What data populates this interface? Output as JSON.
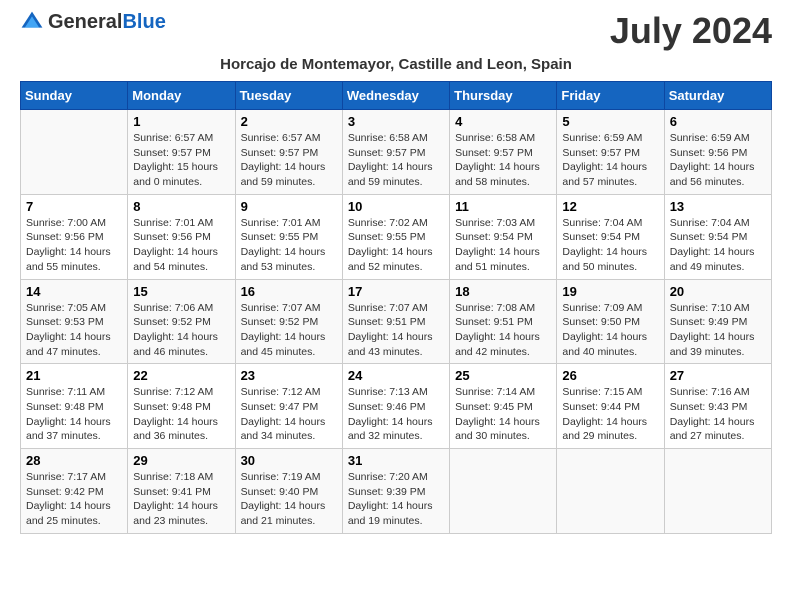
{
  "logo": {
    "general": "General",
    "blue": "Blue"
  },
  "title": "July 2024",
  "location": "Horcajo de Montemayor, Castille and Leon, Spain",
  "headers": [
    "Sunday",
    "Monday",
    "Tuesday",
    "Wednesday",
    "Thursday",
    "Friday",
    "Saturday"
  ],
  "weeks": [
    [
      {
        "date": "",
        "info": ""
      },
      {
        "date": "1",
        "info": "Sunrise: 6:57 AM\nSunset: 9:57 PM\nDaylight: 15 hours\nand 0 minutes."
      },
      {
        "date": "2",
        "info": "Sunrise: 6:57 AM\nSunset: 9:57 PM\nDaylight: 14 hours\nand 59 minutes."
      },
      {
        "date": "3",
        "info": "Sunrise: 6:58 AM\nSunset: 9:57 PM\nDaylight: 14 hours\nand 59 minutes."
      },
      {
        "date": "4",
        "info": "Sunrise: 6:58 AM\nSunset: 9:57 PM\nDaylight: 14 hours\nand 58 minutes."
      },
      {
        "date": "5",
        "info": "Sunrise: 6:59 AM\nSunset: 9:57 PM\nDaylight: 14 hours\nand 57 minutes."
      },
      {
        "date": "6",
        "info": "Sunrise: 6:59 AM\nSunset: 9:56 PM\nDaylight: 14 hours\nand 56 minutes."
      }
    ],
    [
      {
        "date": "7",
        "info": "Sunrise: 7:00 AM\nSunset: 9:56 PM\nDaylight: 14 hours\nand 55 minutes."
      },
      {
        "date": "8",
        "info": "Sunrise: 7:01 AM\nSunset: 9:56 PM\nDaylight: 14 hours\nand 54 minutes."
      },
      {
        "date": "9",
        "info": "Sunrise: 7:01 AM\nSunset: 9:55 PM\nDaylight: 14 hours\nand 53 minutes."
      },
      {
        "date": "10",
        "info": "Sunrise: 7:02 AM\nSunset: 9:55 PM\nDaylight: 14 hours\nand 52 minutes."
      },
      {
        "date": "11",
        "info": "Sunrise: 7:03 AM\nSunset: 9:54 PM\nDaylight: 14 hours\nand 51 minutes."
      },
      {
        "date": "12",
        "info": "Sunrise: 7:04 AM\nSunset: 9:54 PM\nDaylight: 14 hours\nand 50 minutes."
      },
      {
        "date": "13",
        "info": "Sunrise: 7:04 AM\nSunset: 9:54 PM\nDaylight: 14 hours\nand 49 minutes."
      }
    ],
    [
      {
        "date": "14",
        "info": "Sunrise: 7:05 AM\nSunset: 9:53 PM\nDaylight: 14 hours\nand 47 minutes."
      },
      {
        "date": "15",
        "info": "Sunrise: 7:06 AM\nSunset: 9:52 PM\nDaylight: 14 hours\nand 46 minutes."
      },
      {
        "date": "16",
        "info": "Sunrise: 7:07 AM\nSunset: 9:52 PM\nDaylight: 14 hours\nand 45 minutes."
      },
      {
        "date": "17",
        "info": "Sunrise: 7:07 AM\nSunset: 9:51 PM\nDaylight: 14 hours\nand 43 minutes."
      },
      {
        "date": "18",
        "info": "Sunrise: 7:08 AM\nSunset: 9:51 PM\nDaylight: 14 hours\nand 42 minutes."
      },
      {
        "date": "19",
        "info": "Sunrise: 7:09 AM\nSunset: 9:50 PM\nDaylight: 14 hours\nand 40 minutes."
      },
      {
        "date": "20",
        "info": "Sunrise: 7:10 AM\nSunset: 9:49 PM\nDaylight: 14 hours\nand 39 minutes."
      }
    ],
    [
      {
        "date": "21",
        "info": "Sunrise: 7:11 AM\nSunset: 9:48 PM\nDaylight: 14 hours\nand 37 minutes."
      },
      {
        "date": "22",
        "info": "Sunrise: 7:12 AM\nSunset: 9:48 PM\nDaylight: 14 hours\nand 36 minutes."
      },
      {
        "date": "23",
        "info": "Sunrise: 7:12 AM\nSunset: 9:47 PM\nDaylight: 14 hours\nand 34 minutes."
      },
      {
        "date": "24",
        "info": "Sunrise: 7:13 AM\nSunset: 9:46 PM\nDaylight: 14 hours\nand 32 minutes."
      },
      {
        "date": "25",
        "info": "Sunrise: 7:14 AM\nSunset: 9:45 PM\nDaylight: 14 hours\nand 30 minutes."
      },
      {
        "date": "26",
        "info": "Sunrise: 7:15 AM\nSunset: 9:44 PM\nDaylight: 14 hours\nand 29 minutes."
      },
      {
        "date": "27",
        "info": "Sunrise: 7:16 AM\nSunset: 9:43 PM\nDaylight: 14 hours\nand 27 minutes."
      }
    ],
    [
      {
        "date": "28",
        "info": "Sunrise: 7:17 AM\nSunset: 9:42 PM\nDaylight: 14 hours\nand 25 minutes."
      },
      {
        "date": "29",
        "info": "Sunrise: 7:18 AM\nSunset: 9:41 PM\nDaylight: 14 hours\nand 23 minutes."
      },
      {
        "date": "30",
        "info": "Sunrise: 7:19 AM\nSunset: 9:40 PM\nDaylight: 14 hours\nand 21 minutes."
      },
      {
        "date": "31",
        "info": "Sunrise: 7:20 AM\nSunset: 9:39 PM\nDaylight: 14 hours\nand 19 minutes."
      },
      {
        "date": "",
        "info": ""
      },
      {
        "date": "",
        "info": ""
      },
      {
        "date": "",
        "info": ""
      }
    ]
  ]
}
